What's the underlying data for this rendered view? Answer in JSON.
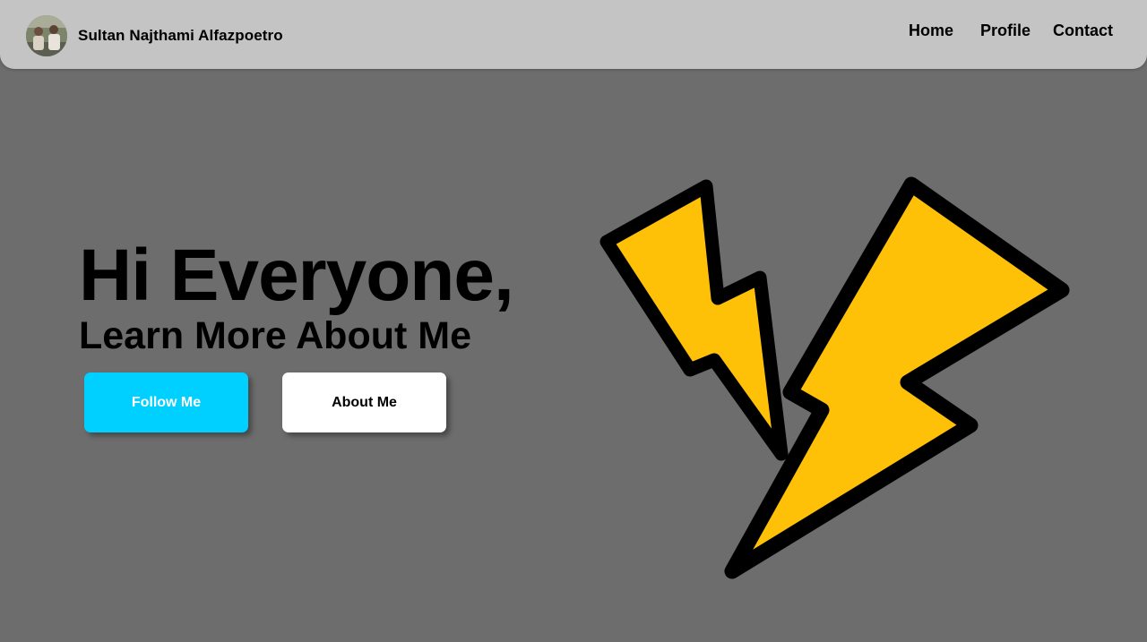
{
  "header": {
    "brand_name": "Sultan Najthami Alfazpoetro",
    "nav": [
      {
        "label": "Home"
      },
      {
        "label": "Profile"
      },
      {
        "label": "Contact"
      }
    ]
  },
  "hero": {
    "title": "Hi Everyone,",
    "subtitle": "Learn More About Me",
    "buttons": {
      "follow_label": "Follow Me",
      "about_label": "About Me"
    }
  },
  "illustration": {
    "icon": "lightning-bolt-icon",
    "fill_color": "#FFC107",
    "outline_color": "#000000"
  },
  "colors": {
    "background": "#6d6d6d",
    "navbar": "#c4c4c4",
    "follow_button": "#00d0ff",
    "about_button": "#ffffff"
  }
}
